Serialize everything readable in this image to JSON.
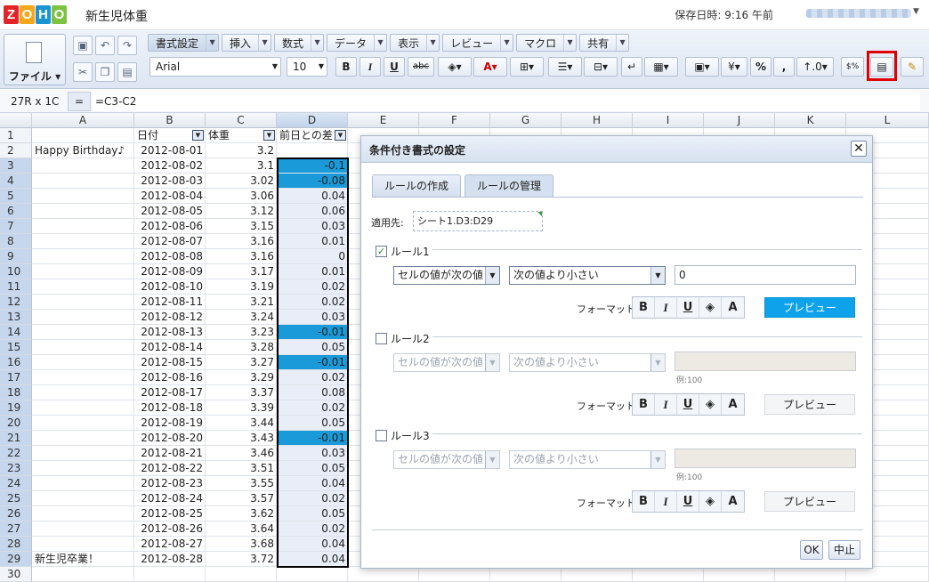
{
  "app": {
    "logo": [
      "Z",
      "O",
      "H",
      "O"
    ],
    "logo_colors": [
      "#e42527",
      "#f6a81a",
      "#1d94d2",
      "#7ec242"
    ],
    "doc_title": "新生児体重",
    "saved": "保存日時: 9:16 午前"
  },
  "ribbon": {
    "file_label": "ファイル",
    "tabs": [
      "書式設定",
      "挿入",
      "数式",
      "データ",
      "表示",
      "レビュー",
      "マクロ",
      "共有"
    ],
    "font": "Arial",
    "size": "10",
    "bold": "B",
    "italic": "I",
    "underline": "U",
    "strike": "abc",
    "currency": "¥",
    "percent": "%",
    "comma": ","
  },
  "formula_bar": {
    "cellref": "27R x 1C",
    "eq": "=",
    "formula": "=C3-C2"
  },
  "columns": [
    "A",
    "B",
    "C",
    "D",
    "E",
    "F",
    "G",
    "H",
    "I",
    "J",
    "K",
    "L"
  ],
  "header_row": {
    "b": "日付",
    "c": "体重",
    "d": "前日との差"
  },
  "rows": [
    {
      "n": "1",
      "a": "",
      "b": "",
      "c": "",
      "d": ""
    },
    {
      "n": "2",
      "a": "Happy Birthday♪",
      "b": "2012-08-01",
      "c": "3.2",
      "d": ""
    },
    {
      "n": "3",
      "a": "",
      "b": "2012-08-02",
      "c": "3.1",
      "d": "-0.1"
    },
    {
      "n": "4",
      "a": "",
      "b": "2012-08-03",
      "c": "3.02",
      "d": "-0.08"
    },
    {
      "n": "5",
      "a": "",
      "b": "2012-08-04",
      "c": "3.06",
      "d": "0.04"
    },
    {
      "n": "6",
      "a": "",
      "b": "2012-08-05",
      "c": "3.12",
      "d": "0.06"
    },
    {
      "n": "7",
      "a": "",
      "b": "2012-08-06",
      "c": "3.15",
      "d": "0.03"
    },
    {
      "n": "8",
      "a": "",
      "b": "2012-08-07",
      "c": "3.16",
      "d": "0.01"
    },
    {
      "n": "9",
      "a": "",
      "b": "2012-08-08",
      "c": "3.16",
      "d": "0"
    },
    {
      "n": "10",
      "a": "",
      "b": "2012-08-09",
      "c": "3.17",
      "d": "0.01"
    },
    {
      "n": "11",
      "a": "",
      "b": "2012-08-10",
      "c": "3.19",
      "d": "0.02"
    },
    {
      "n": "12",
      "a": "",
      "b": "2012-08-11",
      "c": "3.21",
      "d": "0.02"
    },
    {
      "n": "13",
      "a": "",
      "b": "2012-08-12",
      "c": "3.24",
      "d": "0.03"
    },
    {
      "n": "14",
      "a": "",
      "b": "2012-08-13",
      "c": "3.23",
      "d": "-0.01"
    },
    {
      "n": "15",
      "a": "",
      "b": "2012-08-14",
      "c": "3.28",
      "d": "0.05"
    },
    {
      "n": "16",
      "a": "",
      "b": "2012-08-15",
      "c": "3.27",
      "d": "-0.01"
    },
    {
      "n": "17",
      "a": "",
      "b": "2012-08-16",
      "c": "3.29",
      "d": "0.02"
    },
    {
      "n": "18",
      "a": "",
      "b": "2012-08-17",
      "c": "3.37",
      "d": "0.08"
    },
    {
      "n": "19",
      "a": "",
      "b": "2012-08-18",
      "c": "3.39",
      "d": "0.02"
    },
    {
      "n": "20",
      "a": "",
      "b": "2012-08-19",
      "c": "3.44",
      "d": "0.05"
    },
    {
      "n": "21",
      "a": "",
      "b": "2012-08-20",
      "c": "3.43",
      "d": "-0.01"
    },
    {
      "n": "22",
      "a": "",
      "b": "2012-08-21",
      "c": "3.46",
      "d": "0.03"
    },
    {
      "n": "23",
      "a": "",
      "b": "2012-08-22",
      "c": "3.51",
      "d": "0.05"
    },
    {
      "n": "24",
      "a": "",
      "b": "2012-08-23",
      "c": "3.55",
      "d": "0.04"
    },
    {
      "n": "25",
      "a": "",
      "b": "2012-08-24",
      "c": "3.57",
      "d": "0.02"
    },
    {
      "n": "26",
      "a": "",
      "b": "2012-08-25",
      "c": "3.62",
      "d": "0.05"
    },
    {
      "n": "27",
      "a": "",
      "b": "2012-08-26",
      "c": "3.64",
      "d": "0.02"
    },
    {
      "n": "28",
      "a": "",
      "b": "2012-08-27",
      "c": "3.68",
      "d": "0.04"
    },
    {
      "n": "29",
      "a": "新生児卒業！",
      "b": "2012-08-28",
      "c": "3.72",
      "d": "0.04"
    },
    {
      "n": "30",
      "a": "",
      "b": "",
      "c": "",
      "d": ""
    }
  ],
  "dialog": {
    "title": "条件付き書式の設定",
    "tabs": [
      "ルールの作成",
      "ルールの管理"
    ],
    "apply_label": "適用先:",
    "apply_value": "シート1.D3:D29",
    "format_label": "フォーマット",
    "format_buttons": [
      "B",
      "I",
      "U",
      "◈",
      "A"
    ],
    "preview_label": "プレビュー",
    "rules": [
      {
        "label": "ルール1",
        "checked": true,
        "cond": "セルの値が次の値",
        "op": "次の値より小さい",
        "value": "0",
        "hint": ""
      },
      {
        "label": "ルール2",
        "checked": false,
        "cond": "セルの値が次の値",
        "op": "次の値より小さい",
        "value": "",
        "hint": "例:100"
      },
      {
        "label": "ルール3",
        "checked": false,
        "cond": "セルの値が次の値",
        "op": "次の値より小さい",
        "value": "",
        "hint": "例:100"
      }
    ],
    "ok": "OK",
    "cancel": "中止"
  },
  "colors": {
    "cf_fill": "#1b9ad9",
    "selection": "#e8edf8",
    "highlight": "#e10000"
  }
}
